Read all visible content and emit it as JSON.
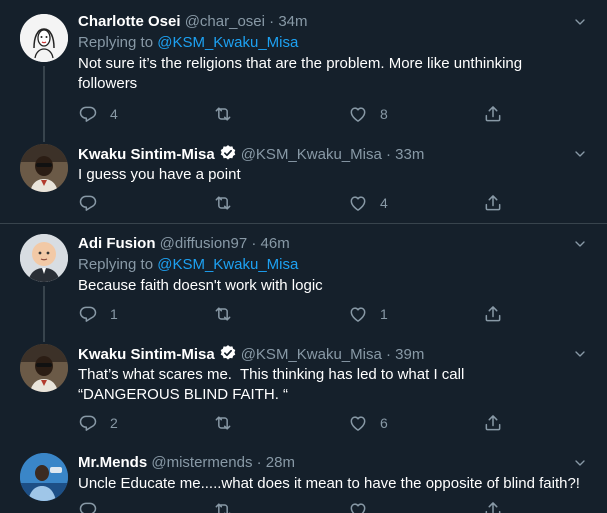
{
  "tweets": [
    {
      "name": "Charlotte Osei",
      "handle": "@char_osei",
      "dot": "·",
      "time": "34m",
      "replying_prefix": "Replying to ",
      "replying_to": "@KSM_Kwaku_Misa",
      "text": "Not sure it’s the religions that are the problem. More like unthinking followers",
      "replies": "4",
      "retweets": "",
      "likes": "8"
    },
    {
      "name": "Kwaku Sintim-Misa",
      "handle": "@KSM_Kwaku_Misa",
      "dot": "·",
      "time": "33m",
      "text": "I guess you have a point",
      "replies": "",
      "retweets": "",
      "likes": "4"
    },
    {
      "name": "Adi Fusion",
      "handle": "@diffusion97",
      "dot": "·",
      "time": "46m",
      "replying_prefix": "Replying to ",
      "replying_to": "@KSM_Kwaku_Misa",
      "text": "Because faith doesn't work with logic",
      "replies": "1",
      "retweets": "",
      "likes": "1"
    },
    {
      "name": "Kwaku Sintim-Misa",
      "handle": "@KSM_Kwaku_Misa",
      "dot": "·",
      "time": "39m",
      "text": "That’s what scares me.  This thinking has led to what I call “DANGEROUS BLIND FAITH. “",
      "replies": "2",
      "retweets": "",
      "likes": "6"
    },
    {
      "name": "Mr.Mends",
      "handle": "@mistermends",
      "dot": "·",
      "time": "28m",
      "text": "Uncle Educate me.....what does it mean to have the opposite of blind faith?!",
      "replies": "",
      "retweets": "",
      "likes": ""
    }
  ],
  "colors": {
    "background": "#15202b",
    "secondary_text": "#8899a6",
    "link": "#1da1f2",
    "divider": "#38444d",
    "verified": "#ffffff"
  },
  "icons": {
    "reply": "reply-icon",
    "retweet": "retweet-icon",
    "like": "like-icon",
    "share": "share-icon",
    "caret": "chevron-down-icon",
    "verified": "verified-badge-icon"
  }
}
